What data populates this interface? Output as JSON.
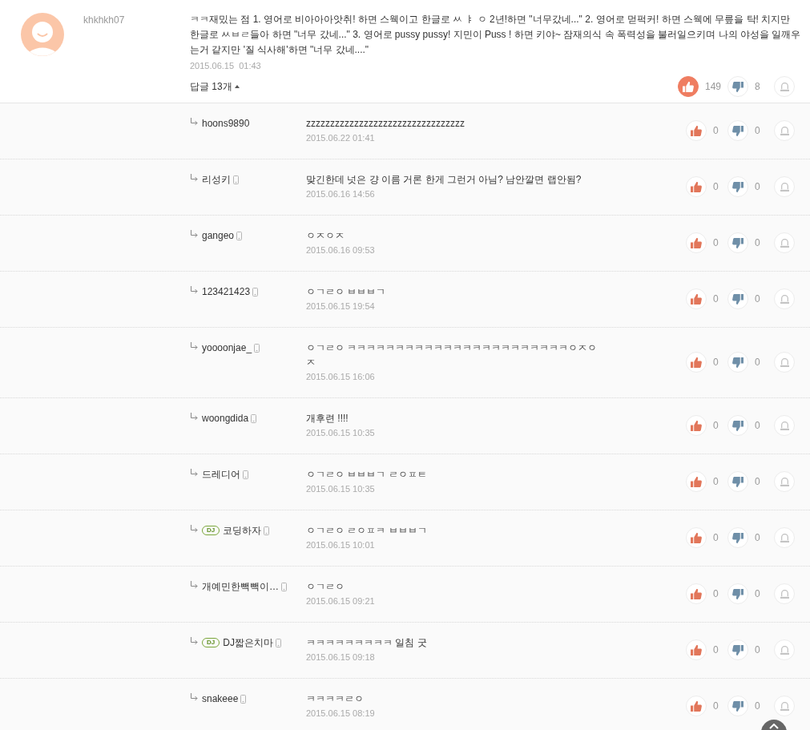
{
  "comment": {
    "author": "khkhkh07",
    "text": "ㅋㅋ재밌는 점 1. 영어로 비아아아앗취! 하면 스웩이고 한글로 ㅆ ㅑ ㅇ 2년!하면 \"너무갔네...\" 2. 영어로 먿퍽커! 하면 스웩에 무릎을 탁! 치지만 한글로 ㅆㅂㄹ들아 하면 \"너무 갔네...\" 3. 영어로 pussy pussy! 지민이 Puss ! 하면 키야~ 잠재의식 속 폭력성을 불러일으키며 나의 야성을 일깨우는거 같지만 '질 식사해'하면 \"너무 갔네....\"",
    "date": "2015.06.15  01:43",
    "replies_toggle": {
      "label": "답글 13개",
      "expanded": true
    },
    "liked": true,
    "likes": "149",
    "dislikes": "8"
  },
  "replies": [
    {
      "author": "hoons9890",
      "mobile": false,
      "text": "zzzzzzzzzzzzzzzzzzzzzzzzzzzzzzzzz",
      "date": "2015.06.22 01:41",
      "liked": false,
      "likes": "0",
      "dislikes": "0"
    },
    {
      "author": "리성키",
      "mobile": true,
      "text": "맞긴한데 넛은 걍 이름 거론 한게 그런거 아님? 남안깔면 랩안됨?",
      "date": "2015.06.16 14:56",
      "liked": false,
      "likes": "0",
      "dislikes": "0"
    },
    {
      "author": "gangeo",
      "mobile": true,
      "text": "ㅇㅈㅇㅈ",
      "date": "2015.06.16 09:53",
      "liked": false,
      "likes": "0",
      "dislikes": "0"
    },
    {
      "author": "123421423",
      "mobile": true,
      "text": "ㅇㄱㄹㅇ ㅂㅂㅂㄱ",
      "date": "2015.06.15 19:54",
      "liked": false,
      "likes": "0",
      "dislikes": "0"
    },
    {
      "author": "yoooonjae_",
      "mobile": true,
      "text": "ㅇㄱㄹㅇ ㅋㅋㅋㅋㅋㅋㅋㅋㅋㅋㅋㅋㅋㅋㅋㅋㅋㅋㅋㅋㅋㅋㅋㅇㅈㅇㅈ",
      "date": "2015.06.15 16:06",
      "liked": false,
      "likes": "0",
      "dislikes": "0"
    },
    {
      "author": "woongdida",
      "mobile": true,
      "text": "개후련 !!!!",
      "date": "2015.06.15 10:35",
      "liked": false,
      "likes": "0",
      "dislikes": "0"
    },
    {
      "author": "드레디어",
      "mobile": true,
      "text": "ㅇㄱㄹㅇ ㅂㅂㅂㄱ ㄹㅇㅍㅌ",
      "date": "2015.06.15 10:35",
      "liked": false,
      "likes": "0",
      "dislikes": "0"
    },
    {
      "author": "코딩하자",
      "badge": "DJ",
      "mobile": true,
      "text": "ㅇㄱㄹㅇ ㄹㅇㅍㅋ ㅂㅂㅂㄱ",
      "date": "2015.06.15 10:01",
      "liked": false,
      "likes": "0",
      "dislikes": "0"
    },
    {
      "author": "개예민한빽빽이…",
      "mobile": true,
      "text": "ㅇㄱㄹㅇ",
      "date": "2015.06.15 09:21",
      "liked": false,
      "likes": "0",
      "dislikes": "0"
    },
    {
      "author": "DJ짧은치마",
      "badge": "DJ",
      "mobile": true,
      "text": "ㅋㅋㅋㅋㅋㅋㅋㅋㅋ 일침 굿",
      "date": "2015.06.15 09:18",
      "liked": false,
      "likes": "0",
      "dislikes": "0"
    },
    {
      "author": "snakeee",
      "mobile": true,
      "text": "ㅋㅋㅋㅋㄹㅇ",
      "date": "2015.06.15 08:19",
      "liked": false,
      "likes": "0",
      "dislikes": "0"
    }
  ]
}
